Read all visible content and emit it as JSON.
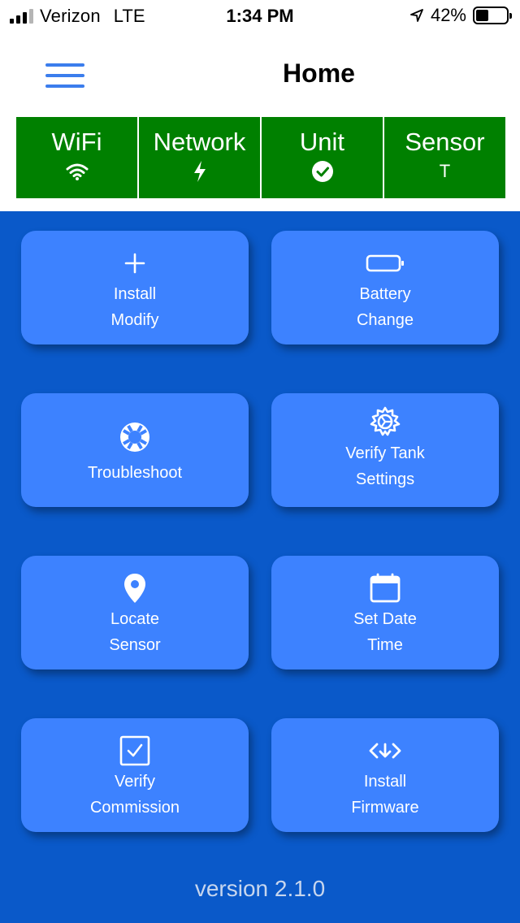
{
  "status_bar": {
    "carrier": "Verizon",
    "network_type": "LTE",
    "time": "1:34 PM",
    "battery_percent": "42%",
    "battery_level": 0.42
  },
  "nav": {
    "title": "Home",
    "menu_icon": "hamburger-menu-icon"
  },
  "status_tiles": [
    {
      "label": "WiFi",
      "icon": "wifi-icon"
    },
    {
      "label": "Network",
      "icon": "bolt-icon"
    },
    {
      "label": "Unit",
      "icon": "check-circle-icon"
    },
    {
      "label": "Sensor",
      "value": "T"
    }
  ],
  "tile_color": "#008000",
  "main_background": "#0a59c9",
  "card_color": "#3d82ff",
  "cards": [
    {
      "line1": "Install",
      "line2": "Modify",
      "icon": "plus-icon"
    },
    {
      "line1": "Battery",
      "line2": "Change",
      "icon": "battery-icon"
    },
    {
      "line1": "Troubleshoot",
      "line2": "",
      "icon": "lifebuoy-icon"
    },
    {
      "line1": "Verify Tank",
      "line2": "Settings",
      "icon": "gear-icon"
    },
    {
      "line1": "Locate",
      "line2": "Sensor",
      "icon": "location-pin-icon"
    },
    {
      "line1": "Set Date",
      "line2": "Time",
      "icon": "calendar-icon"
    },
    {
      "line1": "Verify",
      "line2": "Commission",
      "icon": "checkbox-icon"
    },
    {
      "line1": "Install",
      "line2": "Firmware",
      "icon": "code-download-icon"
    }
  ],
  "version": "version 2.1.0"
}
